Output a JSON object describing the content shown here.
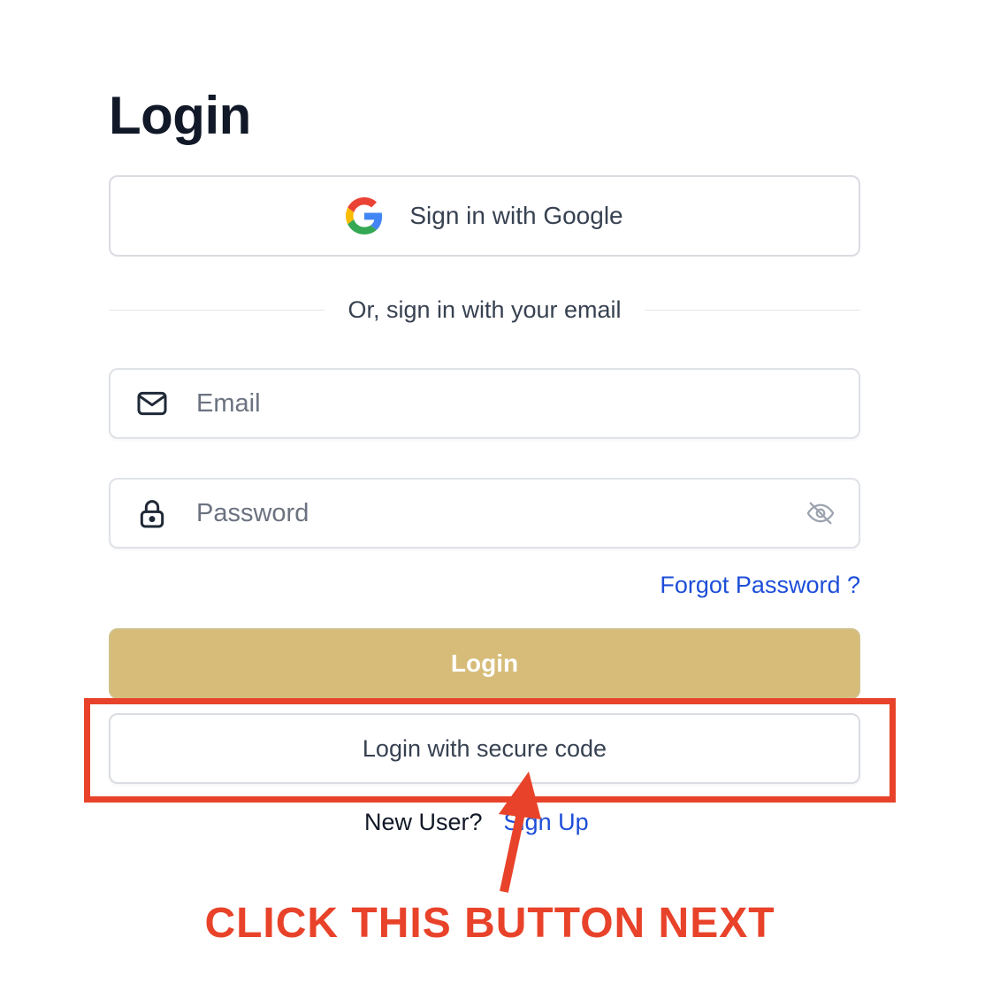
{
  "page": {
    "title": "Login"
  },
  "google_button": {
    "label": "Sign in with Google",
    "icon": "google-logo-icon"
  },
  "divider": {
    "text": "Or, sign in with your email"
  },
  "email_field": {
    "placeholder": "Email",
    "value": "",
    "icon": "mail-icon"
  },
  "password_field": {
    "placeholder": "Password",
    "value": "",
    "icon": "lock-icon",
    "toggle_icon": "eye-off-icon"
  },
  "forgot_password": {
    "label": "Forgot Password ?"
  },
  "login_button": {
    "label": "Login"
  },
  "secure_code_button": {
    "label": "Login with secure code"
  },
  "signup": {
    "prompt": "New User?",
    "link": "Sign Up"
  },
  "annotation": {
    "text": "CLICK THIS BUTTON NEXT",
    "color": "#e8432a"
  },
  "colors": {
    "primary_button": "#d7bc79",
    "link": "#1d4ed8",
    "annotation": "#e8432a"
  }
}
